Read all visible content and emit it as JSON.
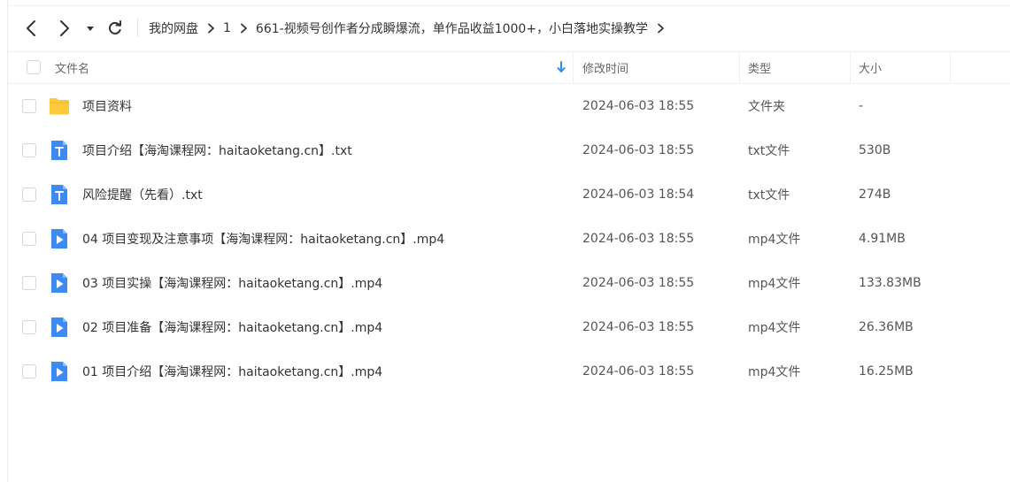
{
  "breadcrumb": {
    "items": [
      "我的网盘",
      "1",
      "661-视频号创作者分成瞬爆流，单作品收益1000+，小白落地实操教学"
    ]
  },
  "columns": {
    "name": "文件名",
    "modified": "修改时间",
    "type": "类型",
    "size": "大小",
    "sort_icon": "arrow-down-icon"
  },
  "rows": [
    {
      "icon": "folder-icon",
      "name": "项目资料",
      "modified": "2024-06-03 18:55",
      "type": "文件夹",
      "size": "-"
    },
    {
      "icon": "text-file-icon",
      "name": "项目介绍【海淘课程网：haitaoketang.cn】.txt",
      "modified": "2024-06-03 18:55",
      "type": "txt文件",
      "size": "530B"
    },
    {
      "icon": "text-file-icon",
      "name": "风险提醒（先看）.txt",
      "modified": "2024-06-03 18:54",
      "type": "txt文件",
      "size": "274B"
    },
    {
      "icon": "video-file-icon",
      "name": "04 项目变现及注意事项【海淘课程网：haitaoketang.cn】.mp4",
      "modified": "2024-06-03 18:55",
      "type": "mp4文件",
      "size": "4.91MB"
    },
    {
      "icon": "video-file-icon",
      "name": "03 项目实操【海淘课程网：haitaoketang.cn】.mp4",
      "modified": "2024-06-03 18:55",
      "type": "mp4文件",
      "size": "133.83MB"
    },
    {
      "icon": "video-file-icon",
      "name": "02 项目准备【海淘课程网：haitaoketang.cn】.mp4",
      "modified": "2024-06-03 18:55",
      "type": "mp4文件",
      "size": "26.36MB"
    },
    {
      "icon": "video-file-icon",
      "name": "01 项目介绍【海淘课程网：haitaoketang.cn】.mp4",
      "modified": "2024-06-03 18:55",
      "type": "mp4文件",
      "size": "16.25MB"
    }
  ],
  "colors": {
    "folder": "#FFC93C",
    "file_blue": "#3D8BF2",
    "sort_arrow": "#2E8BF0"
  }
}
